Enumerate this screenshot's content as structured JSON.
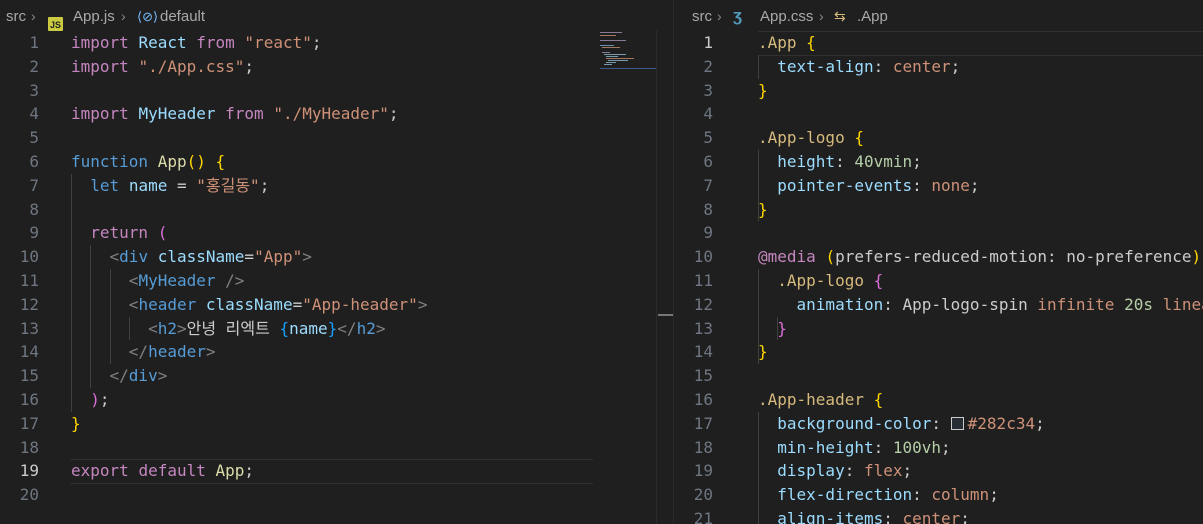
{
  "left": {
    "breadcrumb": {
      "folder": "src",
      "file": "App.js",
      "file_icon": "JS",
      "symbol": "default",
      "symbol_icon": "cube-icon"
    },
    "active_line": 19,
    "lines": [
      {
        "n": "1",
        "tokens": [
          [
            "k",
            "import"
          ],
          [
            "w",
            " "
          ],
          [
            "v",
            "React"
          ],
          [
            "w",
            " "
          ],
          [
            "k",
            "from"
          ],
          [
            "w",
            " "
          ],
          [
            "s",
            "\"react\""
          ],
          [
            "w",
            ";"
          ]
        ]
      },
      {
        "n": "2",
        "tokens": [
          [
            "k",
            "import"
          ],
          [
            "w",
            " "
          ],
          [
            "s",
            "\"./App.css\""
          ],
          [
            "w",
            ";"
          ]
        ]
      },
      {
        "n": "3",
        "tokens": []
      },
      {
        "n": "4",
        "tokens": [
          [
            "k",
            "import"
          ],
          [
            "w",
            " "
          ],
          [
            "v",
            "MyHeader"
          ],
          [
            "w",
            " "
          ],
          [
            "k",
            "from"
          ],
          [
            "w",
            " "
          ],
          [
            "s",
            "\"./MyHeader\""
          ],
          [
            "w",
            ";"
          ]
        ]
      },
      {
        "n": "5",
        "tokens": []
      },
      {
        "n": "6",
        "tokens": [
          [
            "b",
            "function"
          ],
          [
            "w",
            " "
          ],
          [
            "f",
            "App"
          ],
          [
            "y",
            "()"
          ],
          [
            "w",
            " "
          ],
          [
            "y",
            "{"
          ]
        ]
      },
      {
        "n": "7",
        "tokens": [
          [
            "w",
            "  "
          ],
          [
            "b",
            "let"
          ],
          [
            "w",
            " "
          ],
          [
            "v",
            "name"
          ],
          [
            "w",
            " = "
          ],
          [
            "s",
            "\"홍길동\""
          ],
          [
            "w",
            ";"
          ]
        ]
      },
      {
        "n": "8",
        "tokens": []
      },
      {
        "n": "9",
        "tokens": [
          [
            "w",
            "  "
          ],
          [
            "k",
            "return"
          ],
          [
            "w",
            " "
          ],
          [
            "m",
            "("
          ]
        ]
      },
      {
        "n": "10",
        "tokens": [
          [
            "w",
            "    "
          ],
          [
            "pun",
            "<"
          ],
          [
            "t",
            "div"
          ],
          [
            "w",
            " "
          ],
          [
            "v",
            "className"
          ],
          [
            "w",
            "="
          ],
          [
            "s",
            "\"App\""
          ],
          [
            "pun",
            ">"
          ]
        ]
      },
      {
        "n": "11",
        "tokens": [
          [
            "w",
            "      "
          ],
          [
            "pun",
            "<"
          ],
          [
            "t",
            "MyHeader"
          ],
          [
            "w",
            " "
          ],
          [
            "pun",
            "/>"
          ]
        ]
      },
      {
        "n": "12",
        "tokens": [
          [
            "w",
            "      "
          ],
          [
            "pun",
            "<"
          ],
          [
            "t",
            "header"
          ],
          [
            "w",
            " "
          ],
          [
            "v",
            "className"
          ],
          [
            "w",
            "="
          ],
          [
            "s",
            "\"App-header\""
          ],
          [
            "pun",
            ">"
          ]
        ]
      },
      {
        "n": "13",
        "tokens": [
          [
            "w",
            "        "
          ],
          [
            "pun",
            "<"
          ],
          [
            "t",
            "h2"
          ],
          [
            "pun",
            ">"
          ],
          [
            "w",
            "안녕 리엑트 "
          ],
          [
            "bl",
            "{"
          ],
          [
            "v",
            "name"
          ],
          [
            "bl",
            "}"
          ],
          [
            "pun",
            "</"
          ],
          [
            "t",
            "h2"
          ],
          [
            "pun",
            ">"
          ]
        ]
      },
      {
        "n": "14",
        "tokens": [
          [
            "w",
            "      "
          ],
          [
            "pun",
            "</"
          ],
          [
            "t",
            "header"
          ],
          [
            "pun",
            ">"
          ]
        ]
      },
      {
        "n": "15",
        "tokens": [
          [
            "w",
            "    "
          ],
          [
            "pun",
            "</"
          ],
          [
            "t",
            "div"
          ],
          [
            "pun",
            ">"
          ]
        ]
      },
      {
        "n": "16",
        "tokens": [
          [
            "w",
            "  "
          ],
          [
            "m",
            ")"
          ],
          [
            "w",
            ";"
          ]
        ]
      },
      {
        "n": "17",
        "tokens": [
          [
            "y",
            "}"
          ]
        ]
      },
      {
        "n": "18",
        "tokens": []
      },
      {
        "n": "19",
        "tokens": [
          [
            "k",
            "export"
          ],
          [
            "w",
            " "
          ],
          [
            "k",
            "default"
          ],
          [
            "w",
            " "
          ],
          [
            "f",
            "App"
          ],
          [
            "w",
            ";"
          ]
        ]
      },
      {
        "n": "20",
        "tokens": []
      }
    ]
  },
  "right": {
    "breadcrumb": {
      "folder": "src",
      "file": "App.css",
      "file_icon": "css3-icon",
      "symbol": ".App",
      "symbol_icon": "selector-icon"
    },
    "active_line": 1,
    "lines": [
      {
        "n": "1",
        "tokens": [
          [
            "sel",
            ".App"
          ],
          [
            "w",
            " "
          ],
          [
            "y",
            "{"
          ]
        ]
      },
      {
        "n": "2",
        "tokens": [
          [
            "w",
            "  "
          ],
          [
            "p",
            "text-align"
          ],
          [
            "w",
            ": "
          ],
          [
            "s",
            "center"
          ],
          [
            "w",
            ";"
          ]
        ]
      },
      {
        "n": "3",
        "tokens": [
          [
            "y",
            "}"
          ]
        ]
      },
      {
        "n": "4",
        "tokens": []
      },
      {
        "n": "5",
        "tokens": [
          [
            "sel",
            ".App-logo"
          ],
          [
            "w",
            " "
          ],
          [
            "y",
            "{"
          ]
        ]
      },
      {
        "n": "6",
        "tokens": [
          [
            "w",
            "  "
          ],
          [
            "p",
            "height"
          ],
          [
            "w",
            ": "
          ],
          [
            "n",
            "40vmin"
          ],
          [
            "w",
            ";"
          ]
        ]
      },
      {
        "n": "7",
        "tokens": [
          [
            "w",
            "  "
          ],
          [
            "p",
            "pointer-events"
          ],
          [
            "w",
            ": "
          ],
          [
            "s",
            "none"
          ],
          [
            "w",
            ";"
          ]
        ]
      },
      {
        "n": "8",
        "tokens": [
          [
            "y",
            "}"
          ]
        ]
      },
      {
        "n": "9",
        "tokens": []
      },
      {
        "n": "10",
        "tokens": [
          [
            "k",
            "@media"
          ],
          [
            "w",
            " "
          ],
          [
            "y",
            "("
          ],
          [
            "w",
            "prefers-reduced-motion: no-preference"
          ],
          [
            "y",
            ")"
          ],
          [
            "w",
            " "
          ],
          [
            "y",
            "{"
          ]
        ]
      },
      {
        "n": "11",
        "tokens": [
          [
            "w",
            "  "
          ],
          [
            "sel",
            ".App-logo"
          ],
          [
            "w",
            " "
          ],
          [
            "m",
            "{"
          ]
        ]
      },
      {
        "n": "12",
        "tokens": [
          [
            "w",
            "    "
          ],
          [
            "p",
            "animation"
          ],
          [
            "w",
            ": App-logo-spin "
          ],
          [
            "s",
            "infinite"
          ],
          [
            "w",
            " "
          ],
          [
            "n",
            "20s"
          ],
          [
            "w",
            " "
          ],
          [
            "s",
            "linear"
          ],
          [
            "w",
            ";"
          ]
        ]
      },
      {
        "n": "13",
        "tokens": [
          [
            "w",
            "  "
          ],
          [
            "m",
            "}"
          ]
        ]
      },
      {
        "n": "14",
        "tokens": [
          [
            "y",
            "}"
          ]
        ]
      },
      {
        "n": "15",
        "tokens": []
      },
      {
        "n": "16",
        "tokens": [
          [
            "sel",
            ".App-header"
          ],
          [
            "w",
            " "
          ],
          [
            "y",
            "{"
          ]
        ]
      },
      {
        "n": "17",
        "tokens": [
          [
            "w",
            "  "
          ],
          [
            "p",
            "background-color"
          ],
          [
            "w",
            ": "
          ],
          [
            "swatch",
            ""
          ],
          [
            "s",
            "#282c34"
          ],
          [
            "w",
            ";"
          ]
        ]
      },
      {
        "n": "18",
        "tokens": [
          [
            "w",
            "  "
          ],
          [
            "p",
            "min-height"
          ],
          [
            "w",
            ": "
          ],
          [
            "n",
            "100vh"
          ],
          [
            "w",
            ";"
          ]
        ]
      },
      {
        "n": "19",
        "tokens": [
          [
            "w",
            "  "
          ],
          [
            "p",
            "display"
          ],
          [
            "w",
            ": "
          ],
          [
            "s",
            "flex"
          ],
          [
            "w",
            ";"
          ]
        ]
      },
      {
        "n": "20",
        "tokens": [
          [
            "w",
            "  "
          ],
          [
            "p",
            "flex-direction"
          ],
          [
            "w",
            ": "
          ],
          [
            "s",
            "column"
          ],
          [
            "w",
            ";"
          ]
        ]
      },
      {
        "n": "21",
        "tokens": [
          [
            "w",
            "  "
          ],
          [
            "p",
            "align-items"
          ],
          [
            "w",
            ": "
          ],
          [
            "s",
            "center"
          ],
          [
            "w",
            ";"
          ]
        ]
      }
    ]
  }
}
